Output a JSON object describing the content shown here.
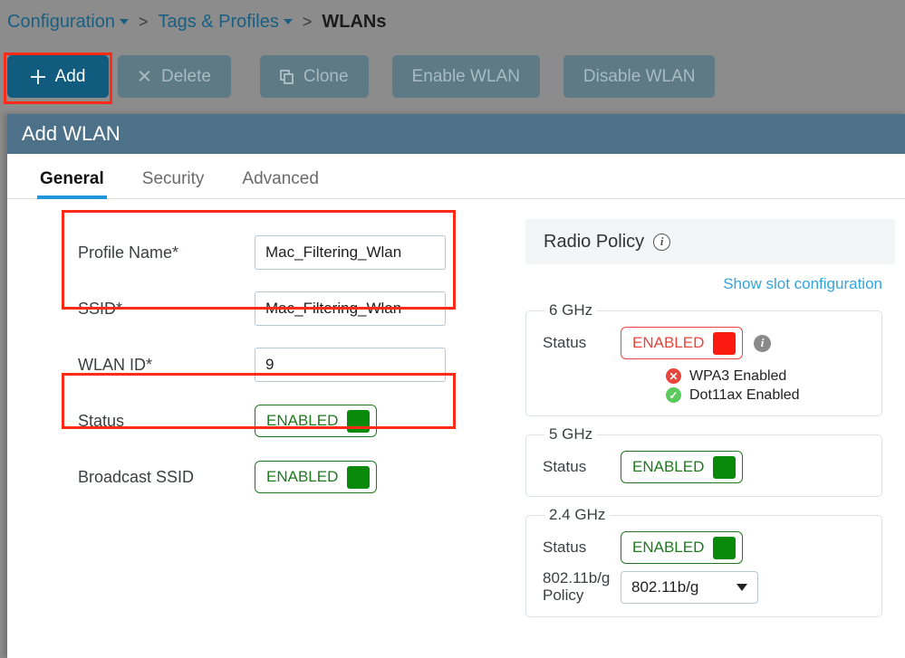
{
  "breadcrumb": {
    "items": [
      {
        "label": "Configuration",
        "caret": true
      },
      {
        "label": "Tags & Profiles",
        "caret": true
      }
    ],
    "separator": ">",
    "current": "WLANs"
  },
  "toolbar": {
    "add_label": "Add",
    "delete_label": "Delete",
    "clone_label": "Clone",
    "enable_label": "Enable WLAN",
    "disable_label": "Disable WLAN"
  },
  "modal": {
    "title": "Add WLAN",
    "tabs": [
      {
        "label": "General",
        "active": true
      },
      {
        "label": "Security",
        "active": false
      },
      {
        "label": "Advanced",
        "active": false
      }
    ]
  },
  "form": {
    "profile_name": {
      "label": "Profile Name*",
      "value": "Mac_Filtering_Wlan"
    },
    "ssid": {
      "label": "SSID*",
      "value": "Mac_Filtering_Wlan"
    },
    "wlan_id": {
      "label": "WLAN ID*",
      "value": "9"
    },
    "status": {
      "label": "Status",
      "toggle": "ENABLED"
    },
    "broadcast_ssid": {
      "label": "Broadcast SSID",
      "toggle": "ENABLED"
    }
  },
  "radio_policy": {
    "title": "Radio Policy",
    "info_icon": "info-icon",
    "slot_link": "Show slot configuration",
    "bands": {
      "six": {
        "legend": "6 GHz",
        "status_label": "Status",
        "toggle": "ENABLED",
        "sub_items": [
          {
            "text": "WPA3 Enabled",
            "state": "error",
            "glyph": "✕"
          },
          {
            "text": "Dot11ax Enabled",
            "state": "ok",
            "glyph": "✓"
          }
        ]
      },
      "five": {
        "legend": "5 GHz",
        "status_label": "Status",
        "toggle": "ENABLED"
      },
      "twofour": {
        "legend": "2.4 GHz",
        "status_label": "Status",
        "toggle": "ENABLED",
        "policy_label": "802.11b/g\nPolicy",
        "policy_value": "802.11b/g"
      }
    }
  },
  "colors": {
    "page_bg": "#8c8c8c",
    "primary_button": "#115c7e",
    "modal_header": "#4d7189",
    "tab_accent": "#2196dd",
    "link": "#35a3de",
    "green": "#0a8a0a",
    "red": "#fb1a10",
    "annotation": "#ff2b16"
  }
}
